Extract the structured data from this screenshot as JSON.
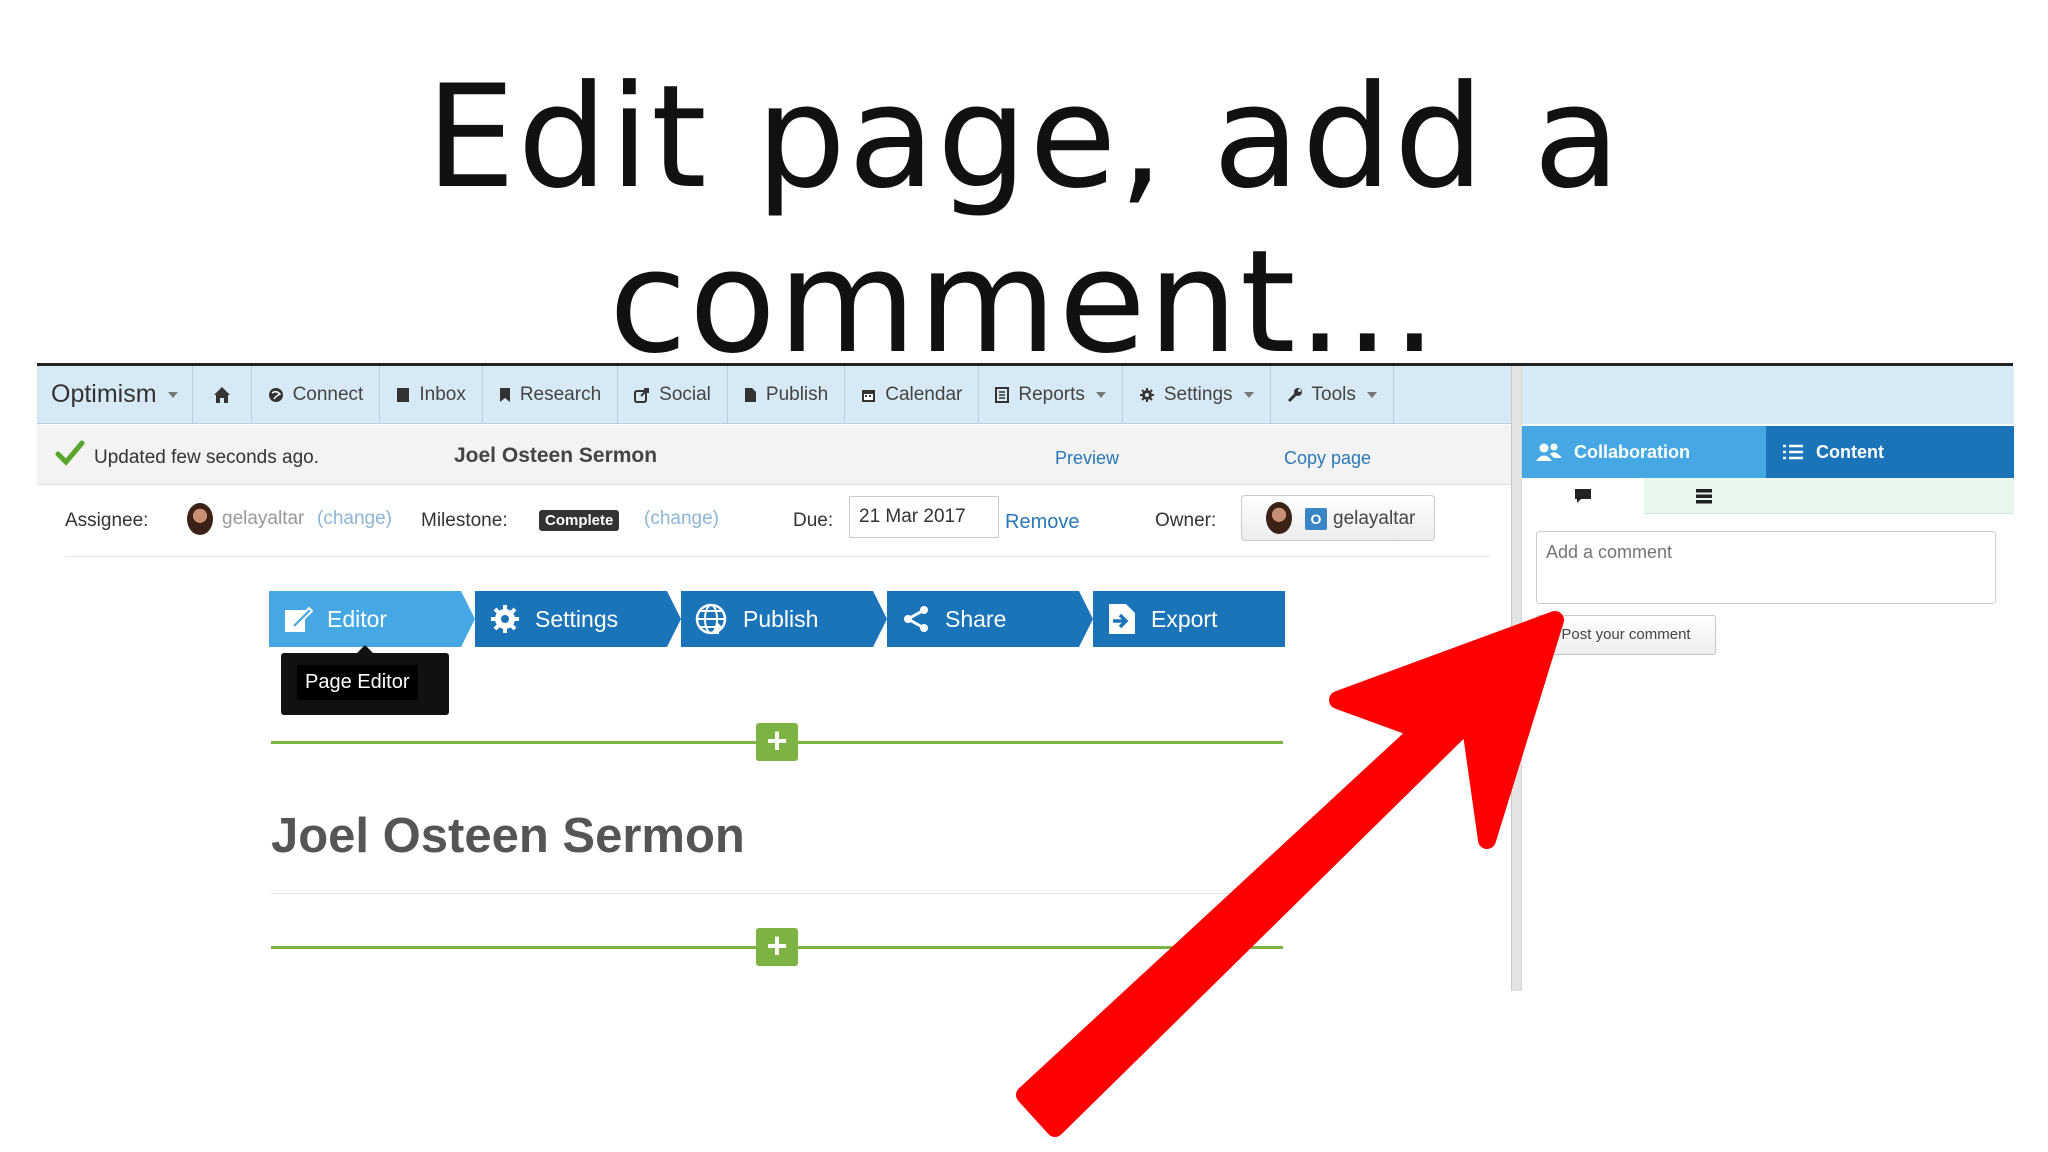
{
  "slide": {
    "title": "Edit page, add a comment..."
  },
  "nav": {
    "brand": "Optimism",
    "items": [
      {
        "label": "Connect",
        "icon": "globe-icon"
      },
      {
        "label": "Inbox",
        "icon": "inbox-icon"
      },
      {
        "label": "Research",
        "icon": "bookmark-icon"
      },
      {
        "label": "Social",
        "icon": "share-icon"
      },
      {
        "label": "Publish",
        "icon": "file-icon"
      },
      {
        "label": "Calendar",
        "icon": "calendar-icon"
      },
      {
        "label": "Reports",
        "icon": "report-icon"
      },
      {
        "label": "Settings",
        "icon": "gear-icon"
      },
      {
        "label": "Tools",
        "icon": "wrench-icon"
      }
    ]
  },
  "status": {
    "updated": "Updated few seconds ago.",
    "doc_title": "Joel Osteen Sermon",
    "preview": "Preview",
    "copy_page": "Copy page"
  },
  "meta": {
    "assignee_label": "Assignee:",
    "assignee": "gelayaltar",
    "change": "(change)",
    "milestone_label": "Milestone:",
    "milestone": "Complete",
    "due_label": "Due:",
    "due_value": "21 Mar 2017",
    "remove": "Remove",
    "owner_label": "Owner:",
    "owner_initial": "O",
    "owner": "gelayaltar"
  },
  "steps": [
    "Editor",
    "Settings",
    "Publish",
    "Share",
    "Export"
  ],
  "tooltip": "Page Editor",
  "page": {
    "heading": "Joel Osteen Sermon",
    "add": "+"
  },
  "right_panel": {
    "tabs": [
      "Collaboration",
      "Content"
    ],
    "comment_placeholder": "Add a comment",
    "post_button": "Post your comment"
  },
  "colors": {
    "accent_light": "#45a8e3",
    "accent_dark": "#1a74b7",
    "nav_bg": "#d7e9f5",
    "add_green": "#7cb342",
    "annotation_red": "#ff0000"
  }
}
